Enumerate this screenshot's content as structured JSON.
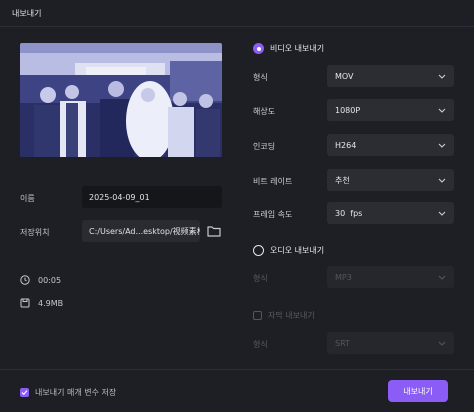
{
  "window": {
    "title": "내보내기"
  },
  "left": {
    "name_label": "이름",
    "name_value": "2025-04-09_01",
    "path_label": "저장위치",
    "path_value": "C:/Users/Ad...esktop/视频素材",
    "duration": "00:05",
    "size": "4.9MB",
    "folder_icon": "folder-icon",
    "clock_icon": "clock-icon",
    "file_icon": "file-size-icon"
  },
  "video": {
    "toggle_label": "비디오 내보내기",
    "selected": true,
    "fields": [
      {
        "label": "형식",
        "value": "MOV"
      },
      {
        "label": "해상도",
        "value": "1080P"
      },
      {
        "label": "인코딩",
        "value": "H264"
      },
      {
        "label": "비트 레이트",
        "value": "추천"
      },
      {
        "label": "프레임 속도",
        "value": "30  fps"
      }
    ]
  },
  "audio": {
    "toggle_label": "오디오 내보내기",
    "selected": false,
    "format_label": "형식",
    "format_value": "MP3"
  },
  "subtitle": {
    "checkbox_label": "자막 내보내기",
    "checked": false,
    "format_label": "형식",
    "format_value": "SRT"
  },
  "footer": {
    "remember_label": "내보내기 매개 변수 저장",
    "remember_checked": true,
    "export_label": "내보내기"
  },
  "colors": {
    "accent": "#8b5cf6",
    "background": "#1e1f24",
    "field": "#2c2d33"
  }
}
